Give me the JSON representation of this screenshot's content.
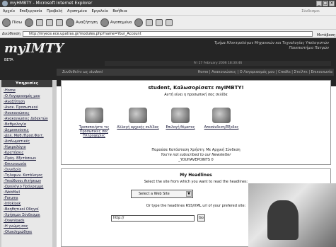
{
  "browser": {
    "title": "myHMBTY - Microsoft Internet Explorer",
    "menu": [
      "Αρχείο",
      "Επεξεργασία",
      "Προβολή",
      "Αγαπημένα",
      "Εργαλεία",
      "Βοήθεια"
    ],
    "links_label": "Σύνδεσμοι",
    "toolbar": {
      "back": "Πίσω",
      "search": "Αναζήτηση",
      "favorites": "Αγαπημένα"
    },
    "address_label": "Διεύθυνση",
    "address": "http://myece.ece.upatras.gr/modules.php?name=Your_Account",
    "go_label": "Μετάβαση"
  },
  "site": {
    "logo": "myIMTY",
    "beta": "BETA",
    "tagline_1": "Τμήμα Ηλεκτρολόγων Μηχανικών και Τεχνολογίας Υπολογιστών",
    "tagline_2": "Πανεπιστήμιο Πατρών",
    "date": "Fri 17 February 2006 18:30:46",
    "connected": "Συνδεθείτε ως student",
    "nav_links": "Home | Ανακοινώσεις | Ο Λογαριασμός μου | Credits | Στείλτε | Επικοινωνία"
  },
  "sidebar": {
    "header": "Υπηρεσίες",
    "items": [
      "Home",
      "Ο Λογαριασμός μου",
      "Αναζήτηση",
      "Ανακ. Προσωπικού",
      "Ανακοινώσεις",
      "Ανακοινώσεις Διδακτών",
      "Βαθμολογία",
      "Δημοσιεύσεις",
      "Δηλ. Μαθ./Προσ.Φοιτ.",
      "Διπλωματικές",
      "Ημερολόγιο",
      "Κρατήσεις",
      "Πρόγ. Εξετάσεων",
      "Επικοινωνία",
      "Συνεδρία",
      "Τηλεφων. Κατάλογος",
      "Υπεύθυνοι Αιτήσεων",
      "Ωρολόγιο Πρόγραμμα",
      "WebMail",
      "Forums",
      "Infokiosk",
      "Βοηθητικοί Οδηγοί",
      "Χρήσιμοι Σύνδεσμοι",
      "Downloads",
      "Η γνώμη σας",
      "Ολοκληρώθηκε"
    ]
  },
  "main": {
    "welcome": "student, Καλωσορίσατε myIMBTY!",
    "subtitle": "Αυτή είναι η προσωπική σας σελίδα",
    "options": [
      {
        "label": "Τροποποιήστε τις Προσωπικές σας Πληροφορίες",
        "icon": "user-edit-icon"
      },
      {
        "label": "Αλλαγή αρχικής σελίδας",
        "icon": "home-page-icon"
      },
      {
        "label": "Επιλογή θέματος",
        "icon": "theme-icon"
      },
      {
        "label": "Αποσύνδεση/Έξοδος",
        "icon": "logout-icon"
      }
    ],
    "status_1": "Παρούσα Κατάσταση Χρήστη: Με Αρχική Σύνδεση",
    "status_2": "You're not subscribed to our Newsletter",
    "status_3": "_YOUHAVEPOINTS 0"
  },
  "headlines": {
    "title": "My Headlines",
    "select_text": "Select the site from which you want to read the headlines:",
    "select_value": "Select a Web Site",
    "or_text": "Or type the headlines RSS/XML url of your prefered site:",
    "url_value": "http://",
    "go": "Go"
  }
}
